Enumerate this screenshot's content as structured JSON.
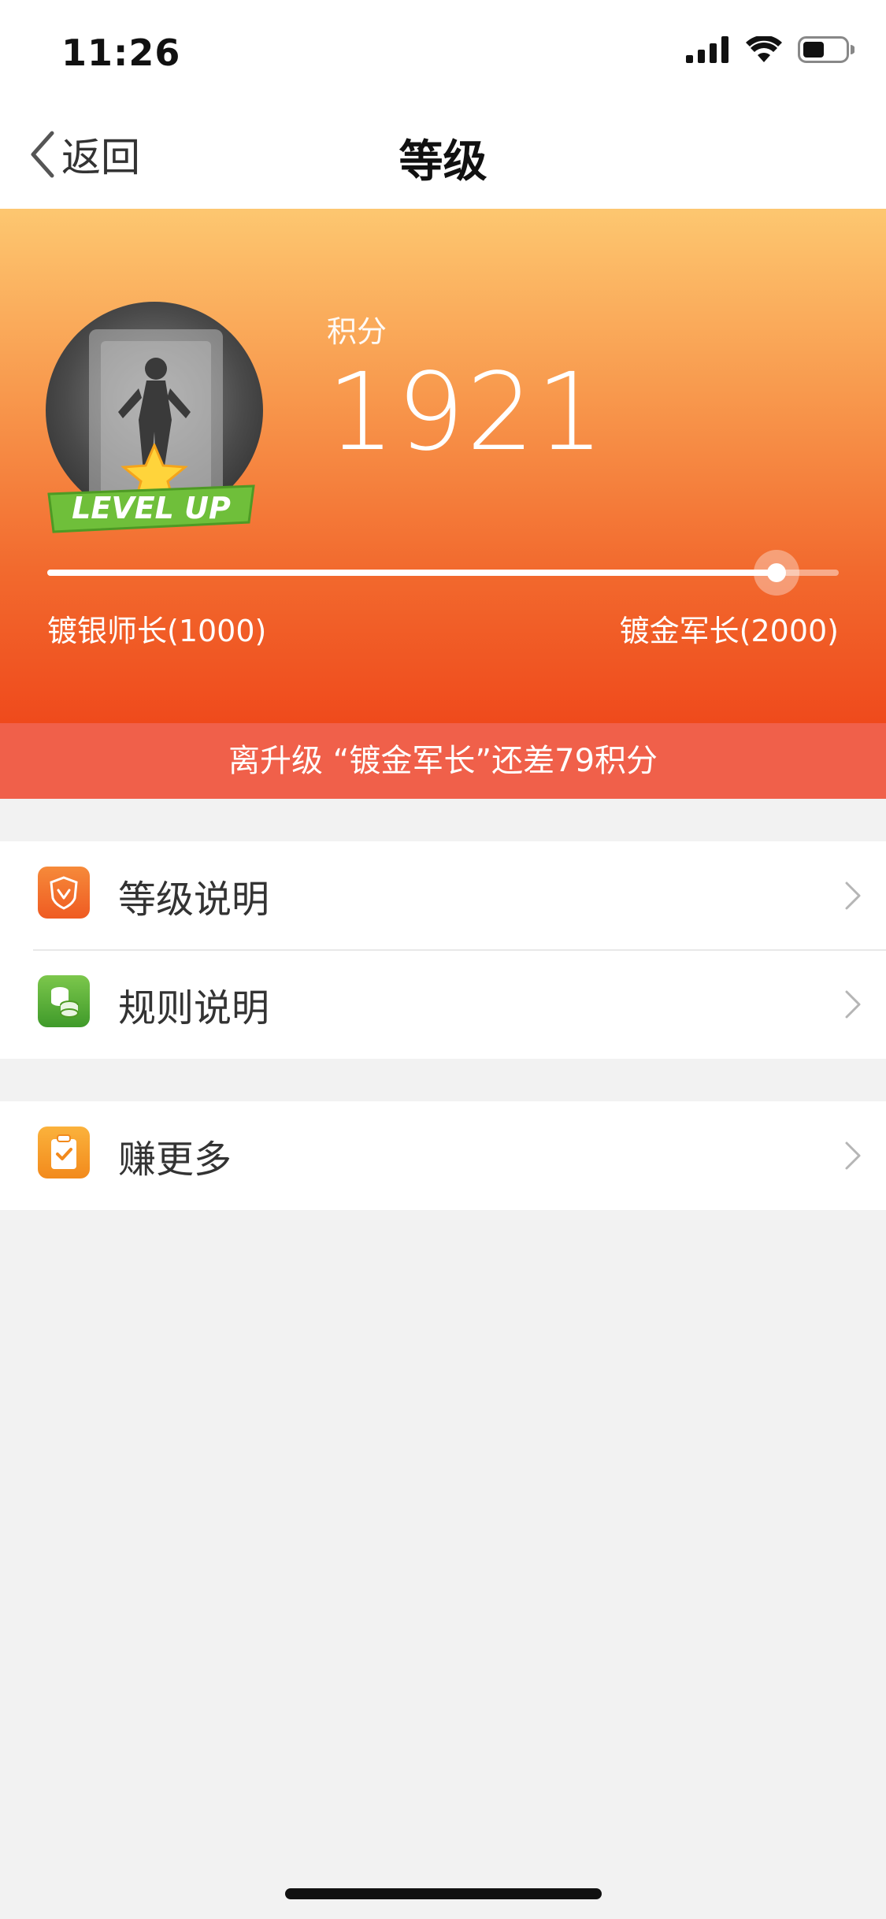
{
  "status_bar": {
    "time": "11:26"
  },
  "nav": {
    "back_label": "返回",
    "title": "等级"
  },
  "header": {
    "badge_text": "LEVEL UP",
    "points_label": "积分",
    "points_value": "1921",
    "progress_fraction": 0.921,
    "current_level": "镀银师长(1000)",
    "next_level": "镀金军长(2000)",
    "upgrade_notice": "离升级 “镀金军长”还差79积分"
  },
  "menu": {
    "group1": [
      {
        "label": "等级说明",
        "icon": "shield-icon",
        "color": "#f26a2e"
      },
      {
        "label": "规则说明",
        "icon": "coins-icon",
        "color": "#5aaf3a"
      }
    ],
    "group2": [
      {
        "label": "赚更多",
        "icon": "clipboard-check-icon",
        "color": "#f7a02a"
      }
    ]
  }
}
